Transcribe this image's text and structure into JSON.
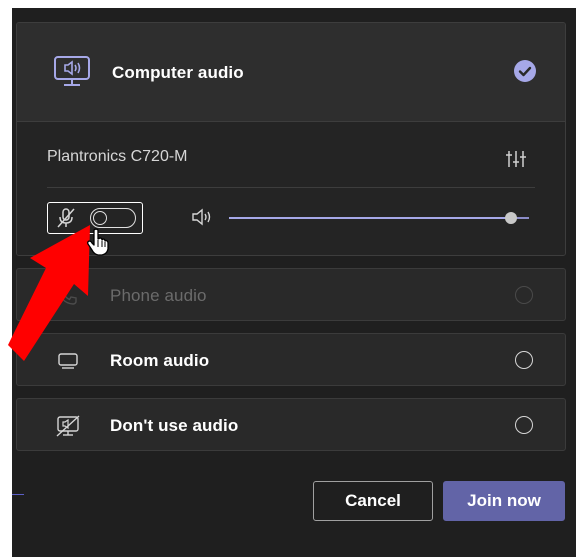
{
  "options": {
    "computer_audio": {
      "label": "Computer audio",
      "selected": true,
      "icon": "monitor-speaker-icon"
    },
    "phone_audio": {
      "label": "Phone audio",
      "enabled": false,
      "icon": "phone-icon"
    },
    "room_audio": {
      "label": "Room audio",
      "icon": "room-device-icon"
    },
    "no_audio": {
      "label": "Don't use audio",
      "icon": "no-audio-icon"
    }
  },
  "computer_audio_settings": {
    "device_name": "Plantronics C720-M",
    "settings_icon": "sliders-icon",
    "mic_icon": "mic-off-icon",
    "mic_on": false,
    "speaker_icon": "speaker-icon",
    "speaker_volume_percent": 94
  },
  "buttons": {
    "cancel": "Cancel",
    "join": "Join now"
  },
  "colors": {
    "background": "#1f1f1f",
    "card": "#292929",
    "accent": "#6264a7",
    "check": "#a6a8e8",
    "annotation_arrow": "#ff0000"
  }
}
